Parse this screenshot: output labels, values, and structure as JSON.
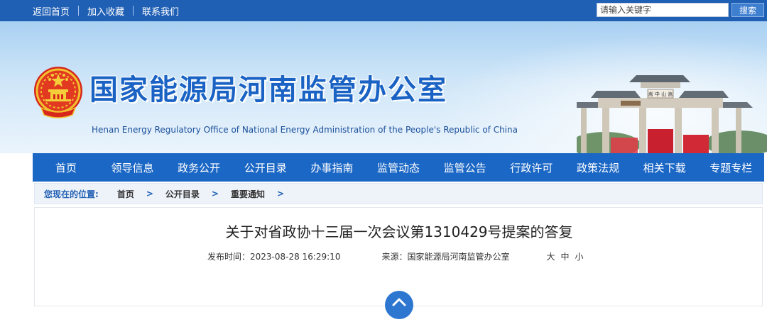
{
  "topbar": {
    "links": [
      "返回首页",
      "加入收藏",
      "联系我们"
    ],
    "search_placeholder": "请输入关键字",
    "search_button": "搜索"
  },
  "banner": {
    "title": "国家能源局河南监管办公室",
    "subtitle": "Henan Energy Regulatory Office of National Energy Administration of the People's Republic of China",
    "gate_plaque": "嵩 中 山 嵩"
  },
  "nav": {
    "items": [
      "首页",
      "领导信息",
      "政务公开",
      "公开目录",
      "办事指南",
      "监管动态",
      "监管公告",
      "行政许可",
      "政策法规",
      "相关下载",
      "专题专栏"
    ]
  },
  "breadcrumb": {
    "lead": "您现在的位置:",
    "items": [
      "首页",
      "公开目录",
      "重要通知"
    ],
    "separator": ">"
  },
  "article": {
    "title": "关于对省政协十三届一次会议第1310429号提案的答复",
    "publish_time": "发布时间：2023-08-28 16:29:10",
    "source": "来源：国家能源局河南监管办公室",
    "font_sizes": [
      "大",
      "中",
      "小"
    ]
  },
  "colors": {
    "brand_blue": "#1b67c5",
    "title_blue": "#1a63c4"
  }
}
